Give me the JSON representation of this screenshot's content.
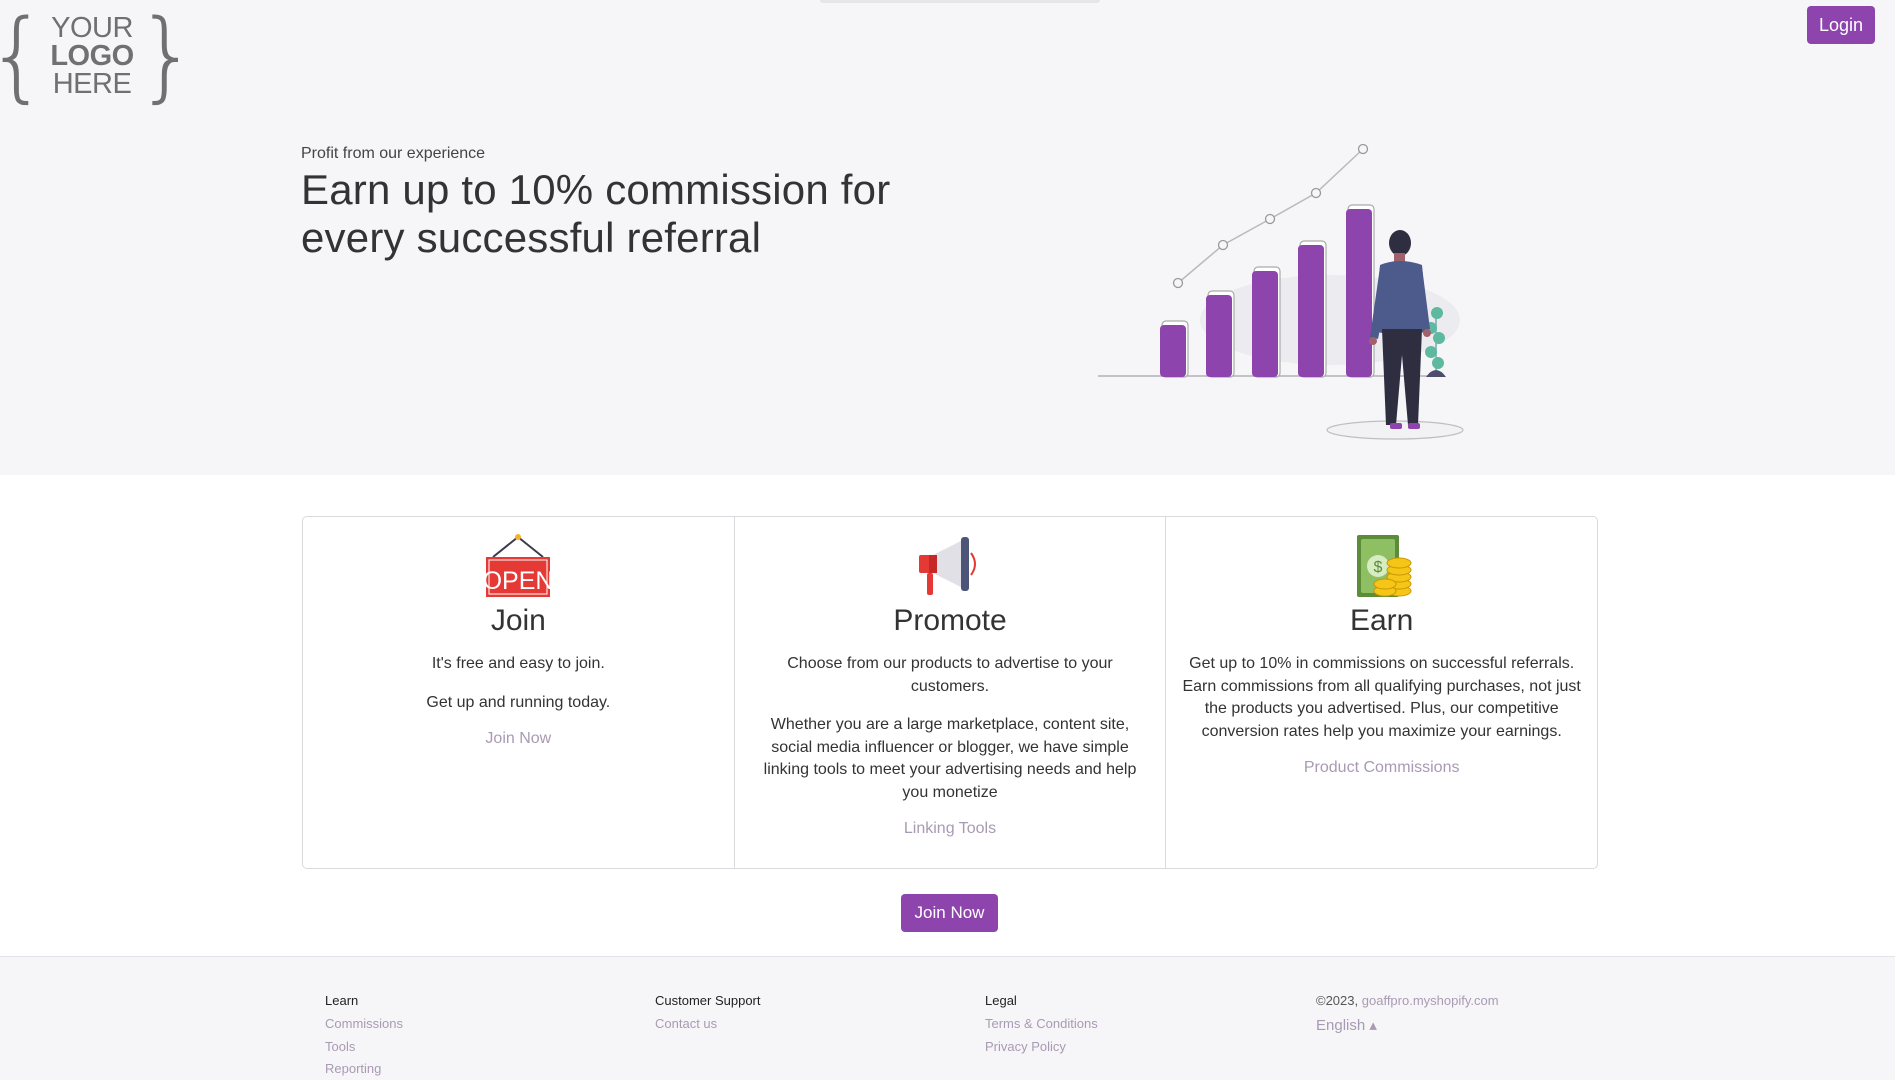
{
  "header": {
    "logo_lines": [
      "YOUR",
      "LOGO",
      "HERE"
    ],
    "login_label": "Login"
  },
  "hero": {
    "eyebrow": "Profit from our experience",
    "headline": "Earn up to 10% commission for every successful referral",
    "illustration": "growth-chart-person-illustration"
  },
  "cards": [
    {
      "icon": "open-sign-icon",
      "icon_text": "OPEN",
      "title": "Join",
      "paragraphs": [
        "It's free and easy to join.",
        "Get up and running today."
      ],
      "link": "Join Now"
    },
    {
      "icon": "megaphone-icon",
      "title": "Promote",
      "paragraphs": [
        "Choose from our products to advertise to your customers.",
        "Whether you are a large marketplace, content site, social media influencer or blogger, we have simple linking tools to meet your advertising needs and help you monetize"
      ],
      "link": "Linking Tools"
    },
    {
      "icon": "money-coins-icon",
      "title": "Earn",
      "paragraphs": [
        "Get up to 10% in commissions on successful referrals. Earn commissions from all qualifying purchases, not just the products you advertised. Plus, our competitive conversion rates help you maximize your earnings."
      ],
      "link": "Product Commissions"
    }
  ],
  "cta": {
    "label": "Join Now"
  },
  "footer": {
    "learn": {
      "title": "Learn",
      "links": [
        "Commissions",
        "Tools",
        "Reporting"
      ]
    },
    "support": {
      "title": "Customer Support",
      "links": [
        "Contact us"
      ]
    },
    "legal": {
      "title": "Legal",
      "links": [
        "Terms & Conditions",
        "Privacy Policy"
      ]
    },
    "copyright_prefix": "©2023,",
    "copyright_site": "goaffpro.myshopify.com",
    "language": "English ▴"
  },
  "colors": {
    "accent": "#8e44ad",
    "link": "#a99ab4",
    "hero_bg": "#f6f6f8"
  }
}
